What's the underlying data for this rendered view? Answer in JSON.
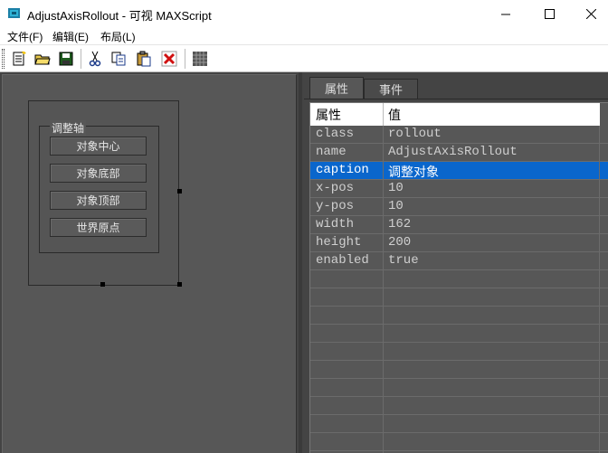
{
  "window": {
    "title": "AdjustAxisRollout - 可视 MAXScript",
    "minimize_glyph": "—",
    "maximize_glyph": "☐",
    "close_glyph": "✕"
  },
  "menu": {
    "items": [
      "文件(F)",
      "编辑(E)",
      "布局(L)"
    ]
  },
  "toolbar": {
    "buttons": [
      "new-file-icon",
      "open-folder-icon",
      "save-icon",
      "cut-icon",
      "copy-icon",
      "paste-icon",
      "delete-icon",
      "grid-icon"
    ]
  },
  "rollout": {
    "group_label": "调整轴",
    "buttons": [
      "对象中心",
      "对象底部",
      "对象顶部",
      "世界原点"
    ]
  },
  "tabs": [
    "属性",
    "事件"
  ],
  "grid": {
    "header": {
      "name": "属性",
      "value": "值"
    },
    "rows": [
      {
        "name": "class",
        "value": "rollout"
      },
      {
        "name": "name",
        "value": "AdjustAxisRollout"
      },
      {
        "name": "caption",
        "value": "调整对象"
      },
      {
        "name": "x-pos",
        "value": "10"
      },
      {
        "name": "y-pos",
        "value": "10"
      },
      {
        "name": "width",
        "value": "162"
      },
      {
        "name": "height",
        "value": "200"
      },
      {
        "name": "enabled",
        "value": "true"
      }
    ],
    "selected_row": "caption"
  },
  "colors": {
    "selection": "#0a66cc",
    "panel_bg": "#575757"
  }
}
